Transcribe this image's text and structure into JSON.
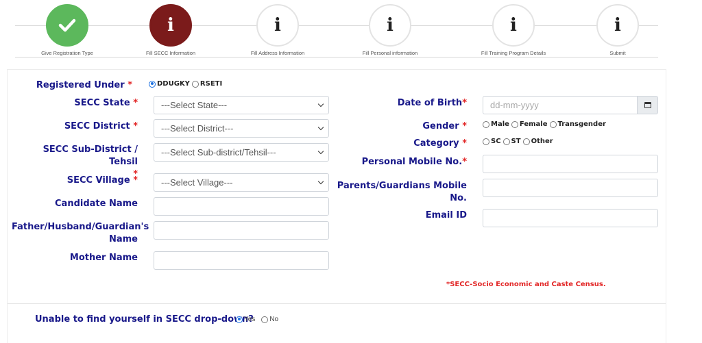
{
  "stepper": {
    "steps": [
      {
        "label": "Give Registration Type",
        "status": "done",
        "icon": "check-icon"
      },
      {
        "label": "Fill SECC Information",
        "status": "current",
        "icon": "info-icon"
      },
      {
        "label": "Fill Address Information",
        "status": "todo",
        "icon": "info-icon"
      },
      {
        "label": "Fill Personal information",
        "status": "todo",
        "icon": "info-icon"
      },
      {
        "label": "Fill Training Program Details",
        "status": "todo",
        "icon": "info-icon"
      },
      {
        "label": "Submit",
        "status": "todo",
        "icon": "info-icon"
      }
    ],
    "icon_glyph": "i",
    "colors": {
      "done": "#5cb85c",
      "current": "#7b1b1b"
    }
  },
  "form": {
    "registered_under": {
      "label": "Registered Under",
      "required": "*",
      "options": [
        "DDUGKY",
        "RSETI"
      ],
      "selected": "DDUGKY"
    },
    "secc_state": {
      "label": "SECC State",
      "required": "*",
      "value": "---Select State---"
    },
    "secc_district": {
      "label": "SECC District",
      "required": "*",
      "value": "---Select District---"
    },
    "secc_subdistrict": {
      "label": "SECC Sub-District / Tehsil",
      "required": "*",
      "value": "---Select Sub-district/Tehsil---"
    },
    "secc_village": {
      "label": "SECC Village",
      "required": "*",
      "value": "---Select Village---"
    },
    "candidate_name": {
      "label": "Candidate Name",
      "value": ""
    },
    "guardian_name": {
      "label_line1": "Father/Husband/Guardian's",
      "label_line2": "Name",
      "value": ""
    },
    "mother_name": {
      "label": "Mother Name",
      "value": ""
    },
    "dob": {
      "label": "Date of Birth",
      "required": "*",
      "placeholder": "dd-mm-yyyy",
      "icon": "calendar-icon"
    },
    "gender": {
      "label": "Gender",
      "required": "*",
      "options": [
        "Male",
        "Female",
        "Transgender"
      ]
    },
    "category": {
      "label": "Category",
      "required": "*",
      "options": [
        "SC",
        "ST",
        "Other"
      ]
    },
    "personal_mobile": {
      "label": "Personal Mobile No.",
      "required": "*",
      "value": ""
    },
    "parents_mobile": {
      "label_line1": "Parents/Guardians Mobile",
      "label_line2": "No.",
      "value": ""
    },
    "email": {
      "label": "Email ID",
      "value": ""
    },
    "secc_note": "*SECC-Socio Economic and Caste Census.",
    "unable_find": {
      "label": "Unable to find yourself in SECC drop-down?",
      "options": [
        "Yes",
        "No"
      ],
      "selected": "Yes"
    }
  },
  "colors": {
    "label": "#19198a",
    "required": "#e22525",
    "radio_accent": "#1a6fe0"
  }
}
